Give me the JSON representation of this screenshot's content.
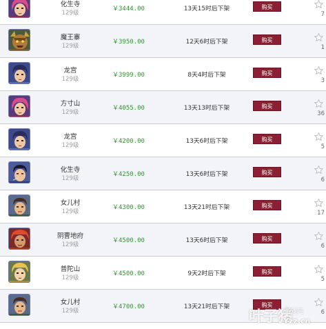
{
  "currency_symbol": "¥",
  "buy_label": "购买",
  "colors": {
    "price": "#2a9a2a",
    "buy_button": "#8c1f33",
    "row_alt": "#f3f4f8",
    "divider": "#c5cbe0"
  },
  "listings": [
    {
      "server": "化生寺",
      "level": "129级",
      "price": "￥3444.00",
      "time_left": "13天15时后下架",
      "favorites": "7",
      "avatar": "pink-hair-character-icon"
    },
    {
      "server": "魔王寨",
      "level": "129级",
      "price": "￥3950.00",
      "time_left": "12天6时后下架",
      "favorites": "1",
      "avatar": "demon-king-character-icon"
    },
    {
      "server": "龙宫",
      "level": "129级",
      "price": "￥3999.00",
      "time_left": "8天4时后下架",
      "favorites": "3",
      "avatar": "dark-hair-character-icon"
    },
    {
      "server": "方寸山",
      "level": "129级",
      "price": "￥4055.00",
      "time_left": "13天13时后下架",
      "favorites": "36",
      "avatar": "pink-hair-character-icon"
    },
    {
      "server": "龙宫",
      "level": "129级",
      "price": "￥4200.00",
      "time_left": "13天6时后下架",
      "favorites": "5",
      "avatar": "dark-hair-character-icon"
    },
    {
      "server": "化生寺",
      "level": "129级",
      "price": "￥4250.00",
      "time_left": "13天6时后下架",
      "favorites": "6",
      "avatar": "swordsman-character-icon"
    },
    {
      "server": "女儿村",
      "level": "129级",
      "price": "￥4300.00",
      "time_left": "13天21时后下架",
      "favorites": "17",
      "avatar": "warrior-character-icon"
    },
    {
      "server": "阴曹地府",
      "level": "129级",
      "price": "￥4500.00",
      "time_left": "13天6时后下架",
      "favorites": "6",
      "avatar": "red-hair-character-icon"
    },
    {
      "server": "普陀山",
      "level": "129级",
      "price": "￥4500.00",
      "time_left": "9天2时后下架",
      "favorites": "5",
      "avatar": "blonde-character-icon"
    },
    {
      "server": "女儿村",
      "level": "129级",
      "price": "￥4700.00",
      "time_left": "13天21时后下架",
      "favorites": "6",
      "avatar": "warrior-character-icon"
    }
  ],
  "watermark": {
    "main": "叶子猪",
    "sub": "游戏网",
    "url": "Yzz.cn"
  }
}
